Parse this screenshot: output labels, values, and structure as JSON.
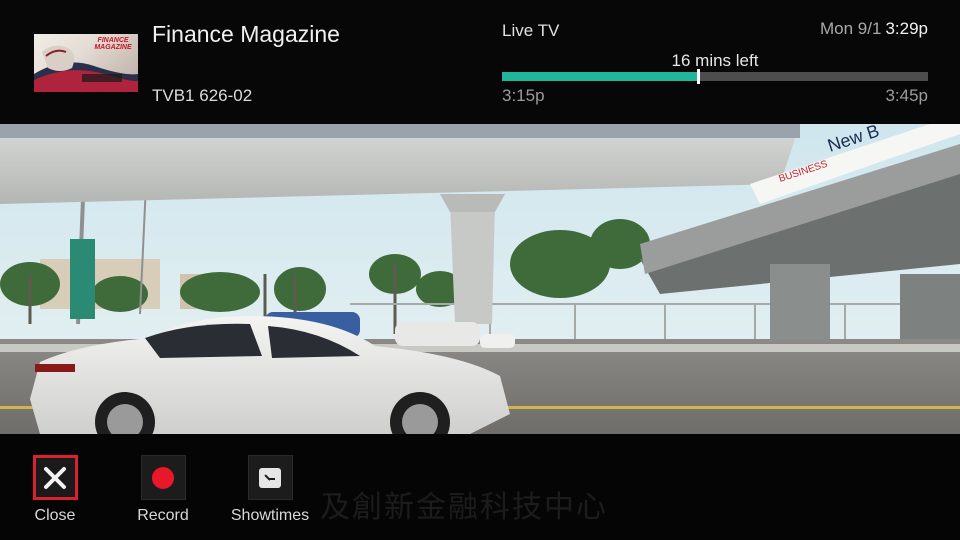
{
  "banner": {
    "thumbnail_text": "FINANCE MAGAZINE",
    "program_title": "Finance Magazine",
    "channel": "TVB1 626-02",
    "live_label": "Live TV",
    "date": "Mon 9/1",
    "current_time": "3:29p",
    "time_left": "16 mins left",
    "start_time": "3:15p",
    "end_time": "3:45p",
    "progress": 0.46,
    "progress_color": "#20b69b"
  },
  "video": {
    "sign_text": "New B",
    "sign_brand": "BUSINESS"
  },
  "actions": [
    {
      "label": "Close",
      "icon": "close-icon",
      "selected": true
    },
    {
      "label": "Record",
      "icon": "record-icon",
      "selected": false
    },
    {
      "label": "Showtimes",
      "icon": "clock-icon",
      "selected": false
    }
  ],
  "subtitle_ghost": "及創新金融科技中心",
  "colors": {
    "accent": "#20b69b",
    "selection": "#d8232e",
    "record": "#e8182a"
  }
}
